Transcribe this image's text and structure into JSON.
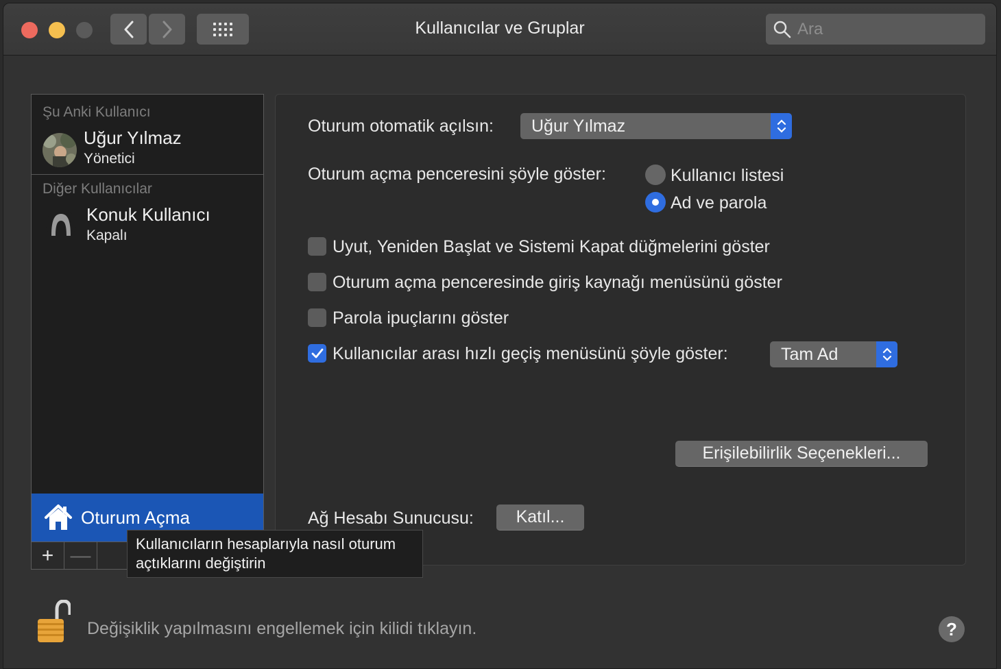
{
  "window": {
    "title": "Kullanıcılar ve Gruplar",
    "search_placeholder": "Ara"
  },
  "sidebar": {
    "current_header": "Şu Anki Kullanıcı",
    "current_user": {
      "name": "Uğur Yılmaz",
      "role": "Yönetici"
    },
    "other_header": "Diğer Kullanıcılar",
    "other_users": [
      {
        "name": "Konuk Kullanıcı",
        "role": "Kapalı"
      }
    ],
    "login_options_label": "Oturum Açma",
    "add_button": "+",
    "remove_button": "—"
  },
  "panel": {
    "auto_login_label": "Oturum otomatik açılsın:",
    "auto_login_value": "Uğur Yılmaz",
    "display_window_label": "Oturum açma penceresini şöyle göster:",
    "radio_options": [
      {
        "label": "Kullanıcı listesi",
        "selected": false
      },
      {
        "label": "Ad ve parola",
        "selected": true
      }
    ],
    "checkboxes": [
      {
        "label": "Uyut, Yeniden Başlat ve Sistemi Kapat düğmelerini göster",
        "checked": false
      },
      {
        "label": "Oturum açma penceresinde giriş kaynağı menüsünü göster",
        "checked": false
      },
      {
        "label": "Parola ipuçlarını göster",
        "checked": false
      },
      {
        "label": "Kullanıcılar arası hızlı geçiş menüsünü şöyle göster:",
        "checked": true
      }
    ],
    "fast_switch_value": "Tam Ad",
    "accessibility_button": "Erişilebilirlik Seçenekleri...",
    "network_server_label": "Ağ Hesabı Sunucusu:",
    "join_button": "Katıl..."
  },
  "tooltip": {
    "line1": "Kullanıcıların hesaplarıyla nasıl oturum",
    "line2": "açtıklarını değiştirin"
  },
  "footer": {
    "lock_text": "Değişiklik yapılmasını engellemek için kilidi tıklayın.",
    "help": "?"
  },
  "colors": {
    "accent": "#2f6de0",
    "selection": "#1b56b5",
    "window_bg": "#323232"
  }
}
